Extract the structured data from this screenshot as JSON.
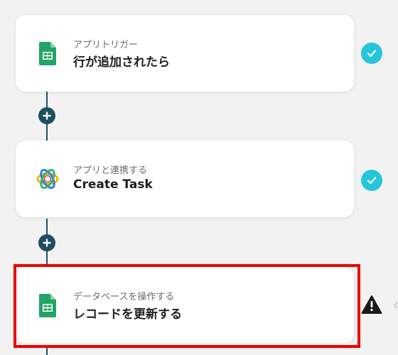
{
  "colors": {
    "background": "#f2f2f2",
    "connector": "#1f4e63",
    "check_badge": "#26c6da",
    "highlight_border": "#ee0000",
    "sheets_green": "#22a565",
    "warning": "#1a1a1a"
  },
  "flow": {
    "steps": [
      {
        "subtitle": "アプリトリガー",
        "title": "行が追加されたら",
        "icon": "google-sheets-icon",
        "status": "check-icon"
      },
      {
        "subtitle": "アプリと連携する",
        "title": "Create Task",
        "icon": "multicolor-ring-app-icon",
        "status": "check-icon"
      },
      {
        "subtitle": "データベースを操作する",
        "title": "レコードを更新する",
        "icon": "google-sheets-icon",
        "status": "warning-icon"
      }
    ],
    "add_buttons": [
      {
        "icon": "plus-icon"
      },
      {
        "icon": "plus-icon"
      }
    ]
  }
}
